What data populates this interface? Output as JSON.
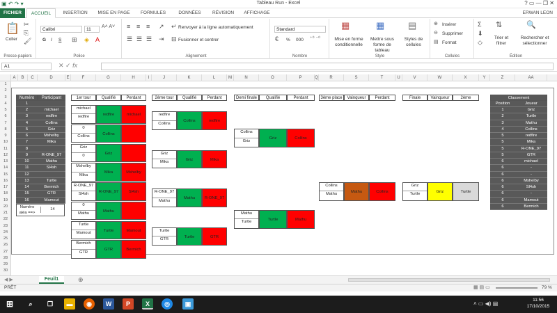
{
  "window": {
    "title": "Tableau Run - Excel",
    "user": "ERWAN LEON"
  },
  "tabs": [
    "FICHIER",
    "ACCUEIL",
    "INSERTION",
    "MISE EN PAGE",
    "FORMULES",
    "DONNÉES",
    "RÉVISION",
    "AFFICHAGE"
  ],
  "ribbon": {
    "clipboard": {
      "paste": "Coller",
      "label": "Presse-papiers"
    },
    "font": {
      "name": "Calibri",
      "size": "11",
      "bold": "G",
      "italic": "I",
      "underline": "S",
      "label": "Police"
    },
    "alignment": {
      "wrap": "Renvoyer à la ligne automatiquement",
      "merge": "Fusionner et centrer",
      "label": "Alignement"
    },
    "number": {
      "format": "Standard",
      "percent": "%",
      "thousands": "000",
      "label": "Nombre"
    },
    "styles": {
      "conditional": "Mise en forme conditionnelle",
      "table": "Mettre sous forme de tableau",
      "cell": "Styles de cellules",
      "label": "Style"
    },
    "cells": {
      "insert": "Insérer",
      "delete": "Supprimer",
      "format": "Format",
      "label": "Cellules"
    },
    "editing": {
      "sort": "Trier et filtrer",
      "find": "Rechercher et sélectionner",
      "label": "Édition"
    }
  },
  "formula_bar": {
    "namebox": "A1",
    "value": ""
  },
  "columns": [
    "A",
    "B",
    "C",
    "D",
    "E",
    "F",
    "G",
    "H",
    "I",
    "J",
    "K",
    "L",
    "M",
    "N",
    "O",
    "P",
    "Q",
    "R",
    "S",
    "T",
    "U",
    "V",
    "W",
    "X",
    "Y",
    "Z",
    "AA"
  ],
  "rows": [
    "1",
    "2",
    "3",
    "4",
    "5",
    "6",
    "7",
    "8",
    "9",
    "10",
    "11",
    "12",
    "13",
    "14",
    "15",
    "16",
    "17",
    "18",
    "19",
    "20",
    "21",
    "22",
    "23",
    "24",
    "25",
    "26",
    "27",
    "28",
    "29",
    "30",
    "31"
  ],
  "participants": {
    "headers": [
      "Numéro",
      "Participant"
    ],
    "items": [
      [
        "1",
        ""
      ],
      [
        "2",
        "michael"
      ],
      [
        "3",
        "redfire"
      ],
      [
        "4",
        "Collins"
      ],
      [
        "5",
        "Griz"
      ],
      [
        "6",
        "Mshelby"
      ],
      [
        "7",
        "Mika"
      ],
      [
        "8",
        ""
      ],
      [
        "9",
        "R-ONE_97"
      ],
      [
        "10",
        "Mathu"
      ],
      [
        "11",
        "Sl4sh"
      ],
      [
        "12",
        ""
      ],
      [
        "13",
        "Turtle"
      ],
      [
        "14",
        "Bermich"
      ],
      [
        "15",
        "GTR"
      ],
      [
        "16",
        "Mamout"
      ]
    ]
  },
  "random": {
    "label1": "Numéro",
    "label2": "aléa ==>",
    "value": "14"
  },
  "round1": {
    "headers": [
      "1er tour",
      "Qualifié",
      "Perdant"
    ],
    "matches": [
      {
        "p1": "michael",
        "p2": "redfire",
        "q": "redfire",
        "l": "michael"
      },
      {
        "p1": "0",
        "p2": "Collins",
        "q": "Collins",
        "l": ""
      },
      {
        "p1": "Griz",
        "p2": "0",
        "q": "Griz",
        "l": ""
      },
      {
        "p1": "Mshelby",
        "p2": "Mika",
        "q": "Mika",
        "l": "Mshelby"
      },
      {
        "p1": "R-ONE_97",
        "p2": "Sl4sh",
        "q": "R-ONE_97",
        "l": "Sl4sh"
      },
      {
        "p1": "0",
        "p2": "Mathu",
        "q": "Mathu",
        "l": ""
      },
      {
        "p1": "Turtle",
        "p2": "Mamout",
        "q": "Turtle",
        "l": "Mamout"
      },
      {
        "p1": "Bermich",
        "p2": "GTR",
        "q": "GTR",
        "l": "Bermich"
      }
    ]
  },
  "round2": {
    "headers": [
      "2ème tour",
      "Qualifié",
      "Perdant"
    ],
    "matches": [
      {
        "p1": "redfire",
        "p2": "Collins",
        "q": "Collins",
        "l": "redfire"
      },
      {
        "p1": "Griz",
        "p2": "Mika",
        "q": "Griz",
        "l": "Mika"
      },
      {
        "p1": "R-ONE_97",
        "p2": "Mathu",
        "q": "Mathu",
        "l": "R-ONE_97"
      },
      {
        "p1": "Turtle",
        "p2": "GTR",
        "q": "Turtle",
        "l": "GTR"
      }
    ]
  },
  "semi": {
    "headers": [
      "Demi finale",
      "Qualifié",
      "Perdant"
    ],
    "matches": [
      {
        "p1": "Collins",
        "p2": "Griz",
        "q": "Griz",
        "l": "Collins"
      },
      {
        "p1": "Mathu",
        "p2": "Turtle",
        "q": "Turtle",
        "l": "Mathu"
      }
    ]
  },
  "third": {
    "headers": [
      "3ème place",
      "Vainqueur",
      "Perdant"
    ],
    "p1": "Collins",
    "p2": "Mathu",
    "w": "Mathu",
    "l": "Collins"
  },
  "final": {
    "headers": [
      "Finale",
      "Vainqueur",
      "2ème"
    ],
    "p1": "Griz",
    "p2": "Turtle",
    "w": "Griz",
    "l": "Turtle"
  },
  "ranking": {
    "title": "Classement",
    "headers": [
      "Position",
      "Joueur"
    ],
    "items": [
      [
        "1",
        "Griz"
      ],
      [
        "2",
        "Turtle"
      ],
      [
        "3",
        "Mathu"
      ],
      [
        "4",
        "Collins"
      ],
      [
        "5",
        "redfire"
      ],
      [
        "5",
        "Mika"
      ],
      [
        "5",
        "R-ONE_97"
      ],
      [
        "5",
        "GTR"
      ],
      [
        "6",
        "michael"
      ],
      [
        "6",
        "-"
      ],
      [
        "6",
        "-"
      ],
      [
        "6",
        "Mshelby"
      ],
      [
        "6",
        "Sl4sh"
      ],
      [
        "6",
        "-"
      ],
      [
        "6",
        "Mamout"
      ],
      [
        "6",
        "Bermich"
      ]
    ]
  },
  "sheet_tab": "Feuil1",
  "status": {
    "ready": "PRÊT",
    "zoom": "79 %"
  },
  "clock": {
    "time": "11:56",
    "date": "17/10/2015"
  }
}
